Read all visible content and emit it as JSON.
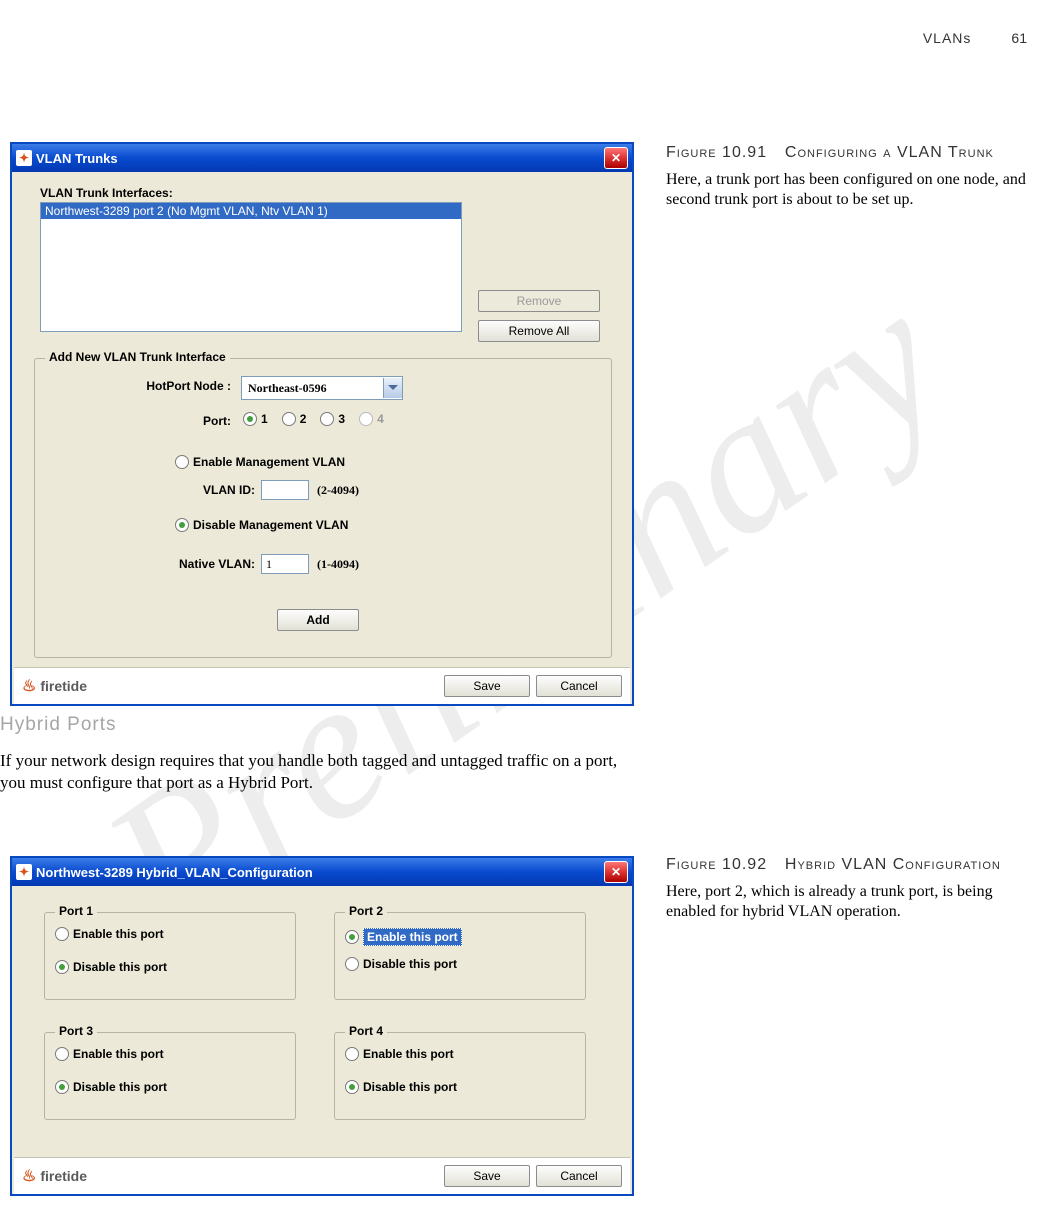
{
  "header": {
    "section": "VLANs",
    "page": "61"
  },
  "watermark": "Preliminary",
  "fig1": {
    "label": "Figure 10.91",
    "title": "Configuring a VLAN Trunk",
    "desc": "Here, a trunk port has been configured on one node, and second trunk port is about to be set up."
  },
  "fig2": {
    "label": "Figure 10.92",
    "title": "Hybrid VLAN Configuration",
    "desc": "Here, port 2, which is already a trunk port, is being enabled for hybrid VLAN operation."
  },
  "heading": "Hybrid Ports",
  "para": "If your network design requires that you handle both tagged and untagged traffic on a port, you must configure that port as a Hybrid Port.",
  "dlg1": {
    "title": "VLAN Trunks",
    "list_label": "VLAN Trunk Interfaces:",
    "list_item": "Northwest-3289 port 2 (No Mgmt VLAN, Ntv VLAN 1)",
    "btn_remove": "Remove",
    "btn_remove_all": "Remove All",
    "group_title": "Add New VLAN Trunk Interface",
    "hotport_label": "HotPort Node :",
    "hotport_value": "Northeast-0596",
    "port_label": "Port:",
    "ports": [
      "1",
      "2",
      "3",
      "4"
    ],
    "enable_mgmt": "Enable Management VLAN",
    "vlan_id_label": "VLAN ID:",
    "vlan_id_hint": "(2-4094)",
    "disable_mgmt": "Disable Management VLAN",
    "native_label": "Native VLAN:",
    "native_value": "1",
    "native_hint": "(1-4094)",
    "add_btn": "Add",
    "save": "Save",
    "cancel": "Cancel",
    "brand": "firetide"
  },
  "dlg2": {
    "title": "Northwest-3289 Hybrid_VLAN_Configuration",
    "ports": [
      {
        "legend": "Port 1",
        "enable": "Enable this port",
        "disable": "Disable this port",
        "sel": "disable"
      },
      {
        "legend": "Port 2",
        "enable": "Enable this port",
        "disable": "Disable this port",
        "sel": "enable"
      },
      {
        "legend": "Port 3",
        "enable": "Enable this port",
        "disable": "Disable this port",
        "sel": "disable"
      },
      {
        "legend": "Port 4",
        "enable": "Enable this port",
        "disable": "Disable this port",
        "sel": "disable"
      }
    ],
    "save": "Save",
    "cancel": "Cancel",
    "brand": "firetide"
  }
}
